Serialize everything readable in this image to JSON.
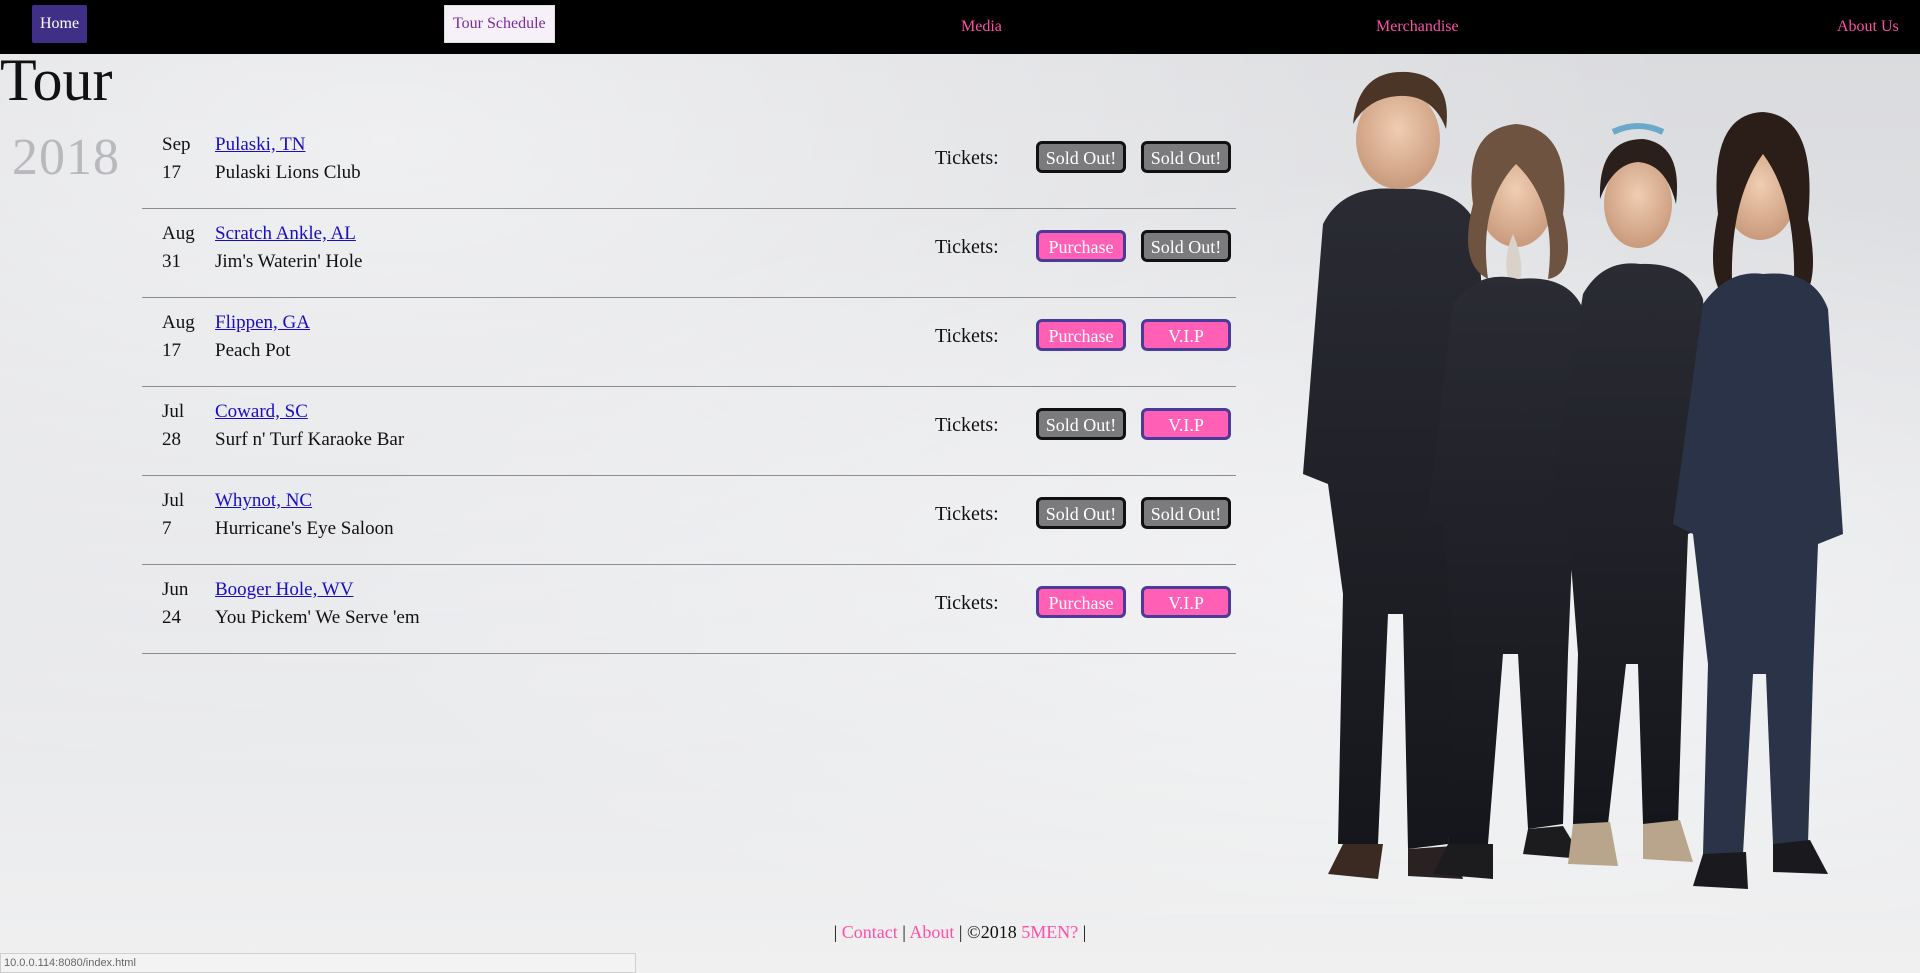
{
  "nav": {
    "items": [
      {
        "label": "Home"
      },
      {
        "label": "Tour Schedule"
      },
      {
        "label": "Media"
      },
      {
        "label": "Merchandise"
      },
      {
        "label": "About Us"
      }
    ]
  },
  "page": {
    "title": "Tour",
    "year": "2018"
  },
  "tour": {
    "tickets_label": "Tickets:",
    "rows": [
      {
        "month": "Sep",
        "day": "17",
        "city": "Pulaski, TN",
        "venue": "Pulaski Lions Club",
        "btn1": "Sold Out!",
        "btn2": "Sold Out!"
      },
      {
        "month": "Aug",
        "day": "31",
        "city": "Scratch Ankle, AL",
        "venue": "Jim's Waterin' Hole",
        "btn1": "Purchase",
        "btn2": "Sold Out!"
      },
      {
        "month": "Aug",
        "day": "17",
        "city": "Flippen, GA",
        "venue": "Peach Pot",
        "btn1": "Purchase",
        "btn2": "V.I.P"
      },
      {
        "month": "Jul",
        "day": "28",
        "city": "Coward, SC",
        "venue": "Surf n' Turf Karaoke Bar",
        "btn1": "Sold Out!",
        "btn2": "V.I.P"
      },
      {
        "month": "Jul",
        "day": "7",
        "city": "Whynot, NC",
        "venue": "Hurricane's Eye Saloon",
        "btn1": "Sold Out!",
        "btn2": "Sold Out!"
      },
      {
        "month": "Jun",
        "day": "24",
        "city": "Booger Hole, WV",
        "venue": "You Pickem' We Serve 'em",
        "btn1": "Purchase",
        "btn2": "V.I.P"
      }
    ]
  },
  "footer": {
    "sep": "|",
    "contact": "Contact",
    "about": "About",
    "copyright": "©2018",
    "brand": "5MEN?"
  },
  "status": {
    "url": "10.0.0.114:8080/index.html"
  },
  "colors": {
    "nav_bg": "#000000",
    "accent": "#ff4fa8",
    "home_bg": "#3f2f86",
    "purchase": "#ff5fb5",
    "soldout": "#7b7b7d"
  }
}
